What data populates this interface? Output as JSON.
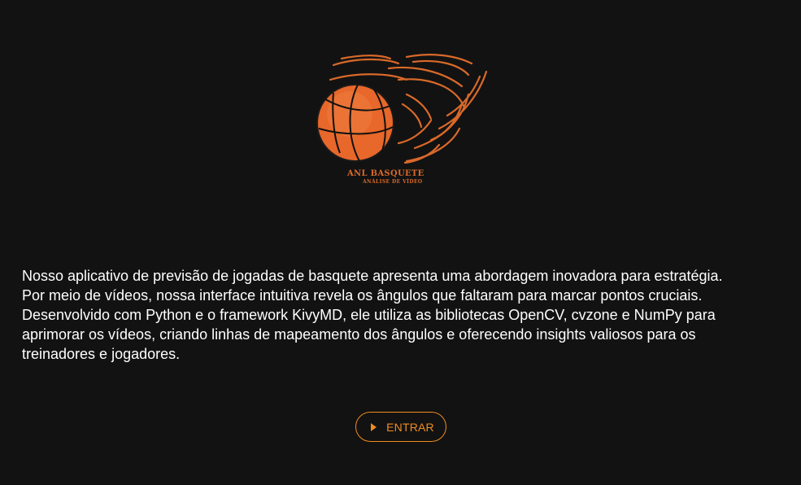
{
  "logo": {
    "title": "ANL BASQUETE",
    "subtitle": "ANÁLISE DE VÍDEO",
    "icon": "basketball-icon",
    "colors": {
      "ball": "#e8672a",
      "lines": "#111111",
      "flames": "#d9692a"
    }
  },
  "description": {
    "text": " Nosso aplicativo de previsão de jogadas de basquete apresenta uma abordagem inovadora para estratégia.\nPor meio de vídeos, nossa interface intuitiva revela os ângulos que faltaram para marcar pontos cruciais.\nDesenvolvido com Python e o framework KivyMD, ele utiliza as bibliotecas OpenCV, cvzone e NumPy para\naprimorar os vídeos, criando linhas de mapeamento dos ângulos e oferecendo insights valiosos para os\ntreinadores e jogadores."
  },
  "enter_button": {
    "label": "ENTRAR",
    "icon": "play-icon",
    "accent": "#f08c1e"
  },
  "theme": {
    "background": "#121212",
    "text": "#ffffff"
  }
}
